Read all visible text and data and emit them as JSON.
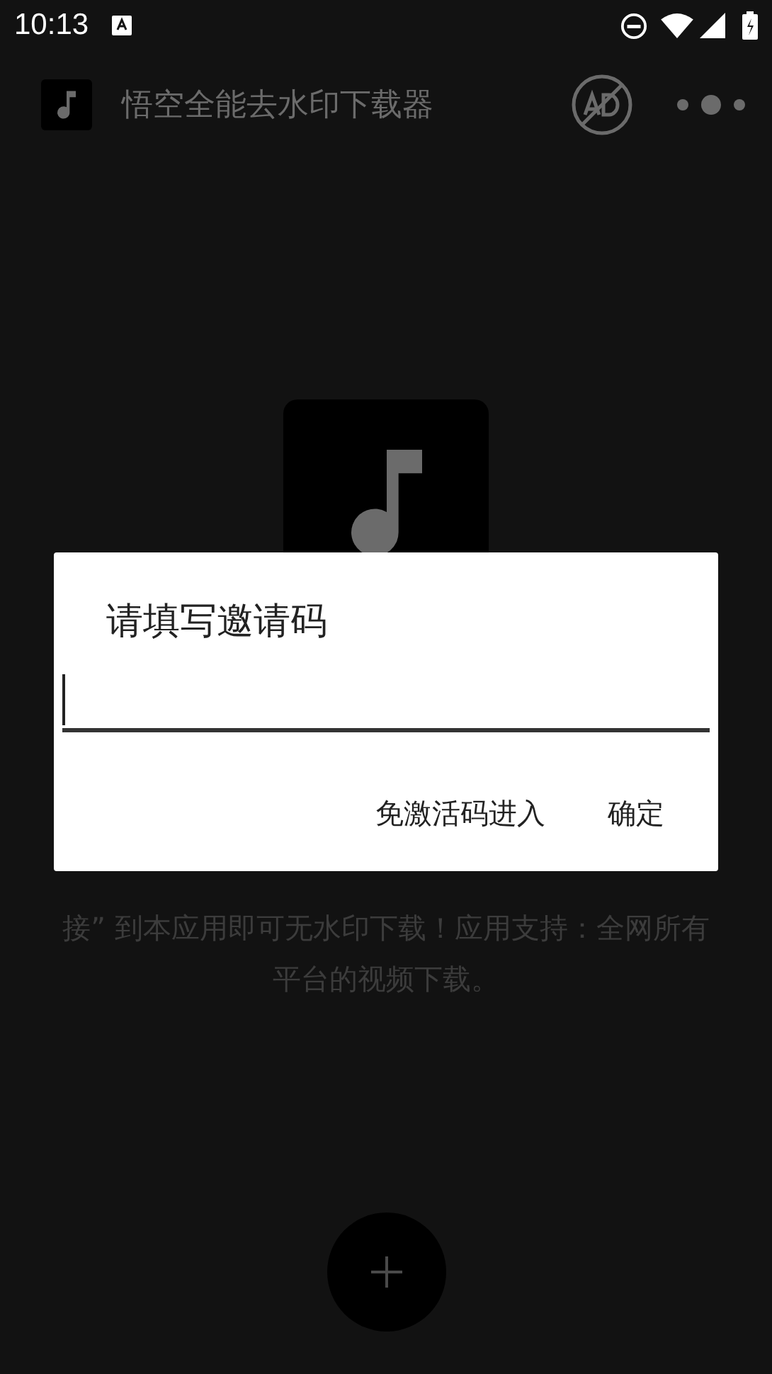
{
  "status_bar": {
    "time": "10:13"
  },
  "toolbar": {
    "title": "悟空全能去水印下载器"
  },
  "instructions": [
    "接” 到本应用即可无水印下载！应用支持：全网所有",
    "平台的视频下载。"
  ],
  "dialog": {
    "title": "请填写邀请码",
    "buttons": [
      "免激活码进入",
      "确定"
    ]
  }
}
